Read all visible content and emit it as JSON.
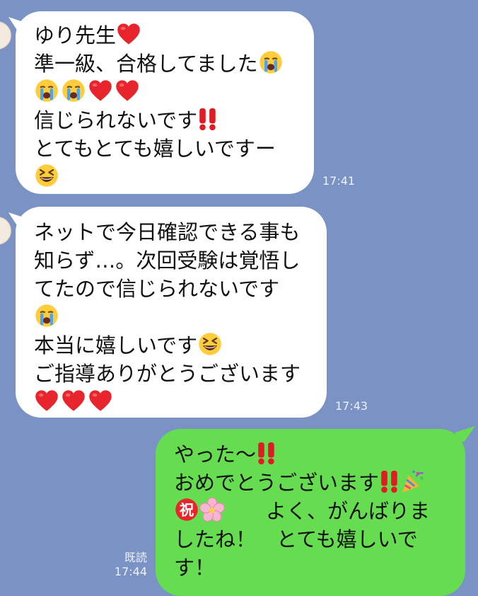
{
  "background_color": "#7a93c4",
  "messages": [
    {
      "direction": "incoming",
      "lines": [
        "ゆり先生",
        "準一級、合格してました",
        "",
        "信じられないです",
        "とてもとても嬉しいですー",
        ""
      ],
      "time": "17:41"
    },
    {
      "direction": "incoming",
      "lines": [
        "ネットで今日確認できる事も",
        "知らず…。次回受験は覚悟し",
        "てたので信じられないです",
        "",
        "本当に嬉しいです",
        "ご指導ありがとうございます",
        ""
      ],
      "time": "17:43"
    },
    {
      "direction": "outgoing",
      "lines": [
        "やった〜",
        "おめでとうございます",
        "　　よく、がんばりま",
        "したね！　とても嬉しいで",
        "す！"
      ],
      "read_label": "既読",
      "time": "17:44"
    }
  ],
  "icons": {
    "heart": "red-heart-icon",
    "crying": "loudly-crying-face-icon",
    "grinning": "grinning-squinting-face-icon",
    "double_exclamation": "double-exclamation-icon",
    "party_popper": "party-popper-icon",
    "congratulations": "congratulations-iwai-icon",
    "cherry_blossom": "cherry-blossom-icon"
  },
  "colors": {
    "incoming_bubble": "#ffffff",
    "outgoing_bubble": "#66dd50",
    "heart": "#e8242c",
    "exclamation": "#e01b24"
  }
}
